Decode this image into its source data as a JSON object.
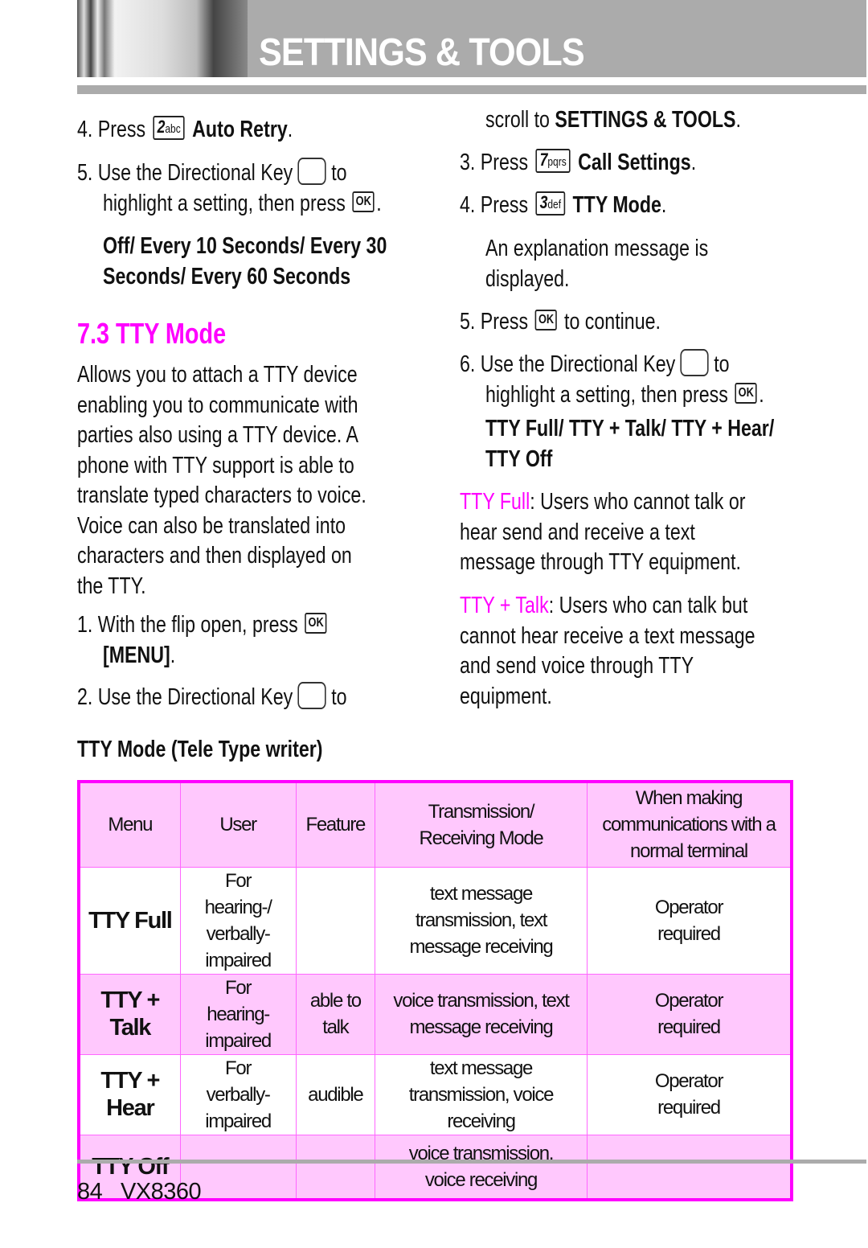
{
  "header": {
    "title": "SETTINGS & TOOLS"
  },
  "left": {
    "s4": {
      "num": "4.",
      "pre": "Press",
      "key": "2",
      "keysub": "abc",
      "bold": "Auto Retry",
      "post": "."
    },
    "s5": {
      "num": "5.",
      "l1": "Use the Directional Key",
      "to": "to",
      "l2": "highlight a setting, then press",
      "ok": "OK",
      "post": "."
    },
    "options": [
      "Off/ Every 10 Seconds/ Every 30",
      "Seconds/ Every 60 Seconds"
    ],
    "heading": "7.3 TTY Mode",
    "para": [
      "Allows you to attach a TTY device",
      "enabling you to communicate with",
      "parties also using a TTY device. A",
      "phone with TTY support is able to",
      "translate typed characters to voice.",
      "Voice can also be translated into",
      "characters and then displayed on",
      "the TTY."
    ],
    "s1": {
      "num": "1.",
      "text": "With the flip open, press",
      "ok": "OK",
      "bold": "[MENU]",
      "post": "."
    },
    "s2": {
      "num": "2.",
      "text": "Use the Directional Key",
      "to": "to"
    }
  },
  "right": {
    "scroll": {
      "pre": "scroll to",
      "bold": "SETTINGS & TOOLS",
      "post": "."
    },
    "s3": {
      "num": "3.",
      "pre": "Press",
      "key": "7",
      "keysub": "pqrs",
      "bold": "Call Settings",
      "post": "."
    },
    "s4": {
      "num": "4.",
      "pre": "Press",
      "key": "3",
      "keysub": "def",
      "bold": "TTY Mode",
      "post": "."
    },
    "explain": [
      "An explanation message is",
      "displayed."
    ],
    "s5": {
      "num": "5.",
      "pre": "Press",
      "ok": "OK",
      "post": "to continue."
    },
    "s6": {
      "num": "6.",
      "l1": "Use the Directional Key",
      "to": "to",
      "l2": "highlight a setting, then press",
      "ok": "OK",
      "post": "."
    },
    "options": [
      "TTY Full/ TTY + Talk/ TTY + Hear/",
      "TTY Off"
    ],
    "full": {
      "term": "TTY Full",
      "l1": ": Users who cannot  talk or",
      "l2": "hear send and receive a text",
      "l3": "message through TTY equipment."
    },
    "talk": {
      "term": "TTY + Talk",
      "l1": ": Users who can talk but",
      "l2": "cannot hear receive a text message",
      "l3": "and send voice through TTY",
      "l4": "equipment."
    }
  },
  "table": {
    "title": "TTY Mode (Tele Type writer)",
    "headers": [
      "Menu",
      "User",
      "Feature",
      "Transmission/ Receiving Mode",
      "When making communications with a normal terminal"
    ],
    "rows": [
      [
        "TTY Full",
        "For hearing-/ verbally-impaired",
        "",
        "text message transmission, text message receiving",
        "Operator required"
      ],
      [
        "TTY + Talk",
        "For hearing-impaired",
        "able to talk",
        "voice transmission, text message receiving",
        "Operator required"
      ],
      [
        "TTY + Hear",
        "For verbally-impaired",
        "audible",
        "text message transmission, voice receiving",
        "Operator required"
      ],
      [
        "TTY Off",
        "",
        "",
        "voice transmission, voice receiving",
        ""
      ]
    ]
  },
  "footer": {
    "page": "84",
    "model": "VX8360"
  }
}
